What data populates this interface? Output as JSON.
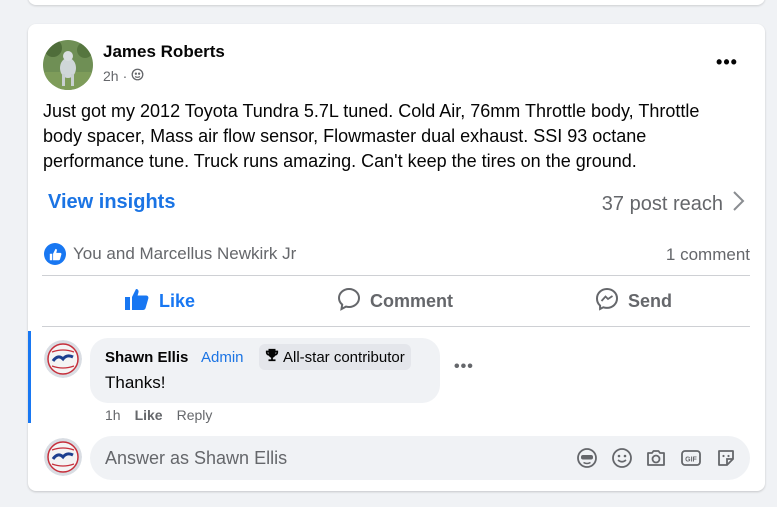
{
  "post": {
    "author": "James Roberts",
    "time": "2h",
    "separator": "·",
    "audience_icon": "globe-icon",
    "more_icon": "•••",
    "text": "Just got my 2012 Toyota Tundra 5.7L tuned. Cold Air, 76mm Throttle body, Throttle body spacer, Mass air flow sensor, Flowmaster dual exhaust. SSI 93 octane performance tune. Truck runs amazing. Can't keep the tires on the ground.",
    "insights_label": "View insights",
    "reach_label": "37 post reach",
    "reactions_label": "You and Marcellus Newkirk Jr",
    "comment_count_label": "1 comment"
  },
  "actions": {
    "like": "Like",
    "comment": "Comment",
    "send": "Send"
  },
  "comment": {
    "author": "Shawn Ellis",
    "role": "Admin",
    "badge": "All-star contributor",
    "text": "Thanks!",
    "time": "1h",
    "like": "Like",
    "reply": "Reply",
    "more_icon": "•••"
  },
  "reply": {
    "placeholder": "Answer as Shawn Ellis"
  },
  "colors": {
    "accent": "#1877f2",
    "link": "#1b74e4",
    "secondary_text": "#65676b",
    "background": "#f0f2f5"
  }
}
